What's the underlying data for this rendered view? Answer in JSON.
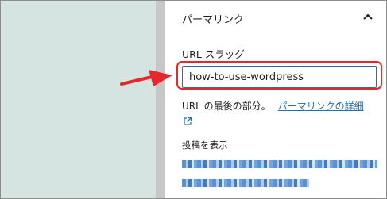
{
  "panel": {
    "title": "パーマリンク",
    "toggle_icon": "chevron-up-icon"
  },
  "slug": {
    "label": "URL スラッグ",
    "value": "how-to-use-wordpress"
  },
  "help": {
    "text": "URL の最後の部分。",
    "link_label": "パーマリンクの詳細",
    "link_icon": "external-link-icon"
  },
  "view_post": {
    "label": "投稿を表示"
  },
  "colors": {
    "accent": "#2271b1",
    "highlight": "#e8262b",
    "canvas": "#d5e4e0"
  }
}
